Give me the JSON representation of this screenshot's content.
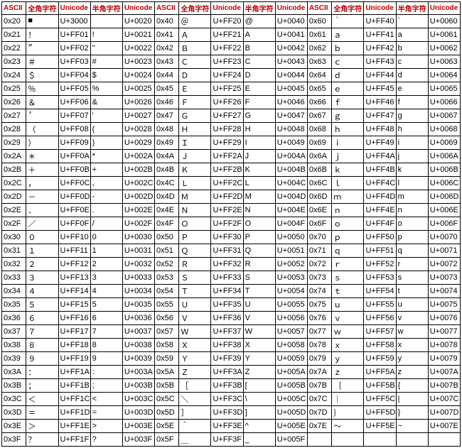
{
  "headers": [
    "ASCII",
    "全角字符",
    "Unicode",
    "半角字符",
    "Unicode"
  ],
  "rows": [
    {
      "a": "0x20",
      "f": "■",
      "u1": "U+3000",
      "h": " ",
      "u2": "U+0020",
      "a2": "0x40",
      "f2": "＠",
      "u12": "U+FF20",
      "h2": "@",
      "u22": "U+0040",
      "a3": "0x60",
      "f3": "｀",
      "u13": "U+FF40",
      "h3": "`",
      "u23": "U+0060"
    },
    {
      "a": "0x21",
      "f": "！",
      "u1": "U+FF01",
      "h": "!",
      "u2": "U+0021",
      "a2": "0x41",
      "f2": "Ａ",
      "u12": "U+FF21",
      "h2": "A",
      "u22": "U+0041",
      "a3": "0x61",
      "f3": "ａ",
      "u13": "U+FF41",
      "h3": "a",
      "u23": "U+0061"
    },
    {
      "a": "0x22",
      "f": "”",
      "u1": "U+FF02",
      "h": "\"",
      "u2": "U+0022",
      "a2": "0x42",
      "f2": "Ｂ",
      "u12": "U+FF22",
      "h2": "B",
      "u22": "U+0042",
      "a3": "0x62",
      "f3": "ｂ",
      "u13": "U+FF42",
      "h3": "b",
      "u23": "U+0062"
    },
    {
      "a": "0x23",
      "f": "＃",
      "u1": "U+FF03",
      "h": "#",
      "u2": "U+0023",
      "a2": "0x43",
      "f2": "Ｃ",
      "u12": "U+FF23",
      "h2": "C",
      "u22": "U+0043",
      "a3": "0x63",
      "f3": "ｃ",
      "u13": "U+FF43",
      "h3": "c",
      "u23": "U+0063"
    },
    {
      "a": "0x24",
      "f": "＄",
      "u1": "U+FF04",
      "h": "$",
      "u2": "U+0024",
      "a2": "0x44",
      "f2": "Ｄ",
      "u12": "U+FF24",
      "h2": "D",
      "u22": "U+0044",
      "a3": "0x64",
      "f3": "ｄ",
      "u13": "U+FF44",
      "h3": "d",
      "u23": "U+0064"
    },
    {
      "a": "0x25",
      "f": "％",
      "u1": "U+FF05",
      "h": "%",
      "u2": "U+0025",
      "a2": "0x45",
      "f2": "Ｅ",
      "u12": "U+FF25",
      "h2": "E",
      "u22": "U+0045",
      "a3": "0x65",
      "f3": "ｅ",
      "u13": "U+FF45",
      "h3": "e",
      "u23": "U+0065"
    },
    {
      "a": "0x26",
      "f": "＆",
      "u1": "U+FF06",
      "h": "&",
      "u2": "U+0026",
      "a2": "0x46",
      "f2": "Ｆ",
      "u12": "U+FF26",
      "h2": "F",
      "u22": "U+0046",
      "a3": "0x66",
      "f3": "ｆ",
      "u13": "U+FF46",
      "h3": "f",
      "u23": "U+0066"
    },
    {
      "a": "0x27",
      "f": "’",
      "u1": "U+FF07",
      "h": "'",
      "u2": "U+0027",
      "a2": "0x47",
      "f2": "Ｇ",
      "u12": "U+FF27",
      "h2": "G",
      "u22": "U+0047",
      "a3": "0x67",
      "f3": "ｇ",
      "u13": "U+FF47",
      "h3": "g",
      "u23": "U+0067"
    },
    {
      "a": "0x28",
      "f": "（",
      "u1": "U+FF08",
      "h": "(",
      "u2": "U+0028",
      "a2": "0x48",
      "f2": "Ｈ",
      "u12": "U+FF28",
      "h2": "H",
      "u22": "U+0048",
      "a3": "0x68",
      "f3": "ｈ",
      "u13": "U+FF48",
      "h3": "h",
      "u23": "U+0068"
    },
    {
      "a": "0x29",
      "f": "）",
      "u1": "U+FF09",
      "h": ")",
      "u2": "U+0029",
      "a2": "0x49",
      "f2": "Ｉ",
      "u12": "U+FF29",
      "h2": "I",
      "u22": "U+0049",
      "a3": "0x69",
      "f3": "ｉ",
      "u13": "U+FF49",
      "h3": "i",
      "u23": "U+0069"
    },
    {
      "a": "0x2A",
      "f": "＊",
      "u1": "U+FF0A",
      "h": "*",
      "u2": "U+002A",
      "a2": "0x4A",
      "f2": "Ｊ",
      "u12": "U+FF2A",
      "h2": "J",
      "u22": "U+004A",
      "a3": "0x6A",
      "f3": "ｊ",
      "u13": "U+FF4A",
      "h3": "j",
      "u23": "U+006A"
    },
    {
      "a": "0x2B",
      "f": "＋",
      "u1": "U+FF0B",
      "h": "+",
      "u2": "U+002B",
      "a2": "0x4B",
      "f2": "Ｋ",
      "u12": "U+FF2B",
      "h2": "K",
      "u22": "U+004B",
      "a3": "0x6B",
      "f3": "ｋ",
      "u13": "U+FF4B",
      "h3": "k",
      "u23": "U+006B"
    },
    {
      "a": "0x2C",
      "f": "，",
      "u1": "U+FF0C",
      "h": ",",
      "u2": "U+002C",
      "a2": "0x4C",
      "f2": "Ｌ",
      "u12": "U+FF2C",
      "h2": "L",
      "u22": "U+004C",
      "a3": "0x6C",
      "f3": "ｌ",
      "u13": "U+FF4C",
      "h3": "l",
      "u23": "U+006C"
    },
    {
      "a": "0x2D",
      "f": "－",
      "u1": "U+FF0D",
      "h": "-",
      "u2": "U+002D",
      "a2": "0x4D",
      "f2": "Ｍ",
      "u12": "U+FF2D",
      "h2": "M",
      "u22": "U+004D",
      "a3": "0x6D",
      "f3": "ｍ",
      "u13": "U+FF4D",
      "h3": "m",
      "u23": "U+006D"
    },
    {
      "a": "0x2E",
      "f": "．",
      "u1": "U+FF0E",
      "h": ".",
      "u2": "U+002E",
      "a2": "0x4E",
      "f2": "Ｎ",
      "u12": "U+FF2E",
      "h2": "N",
      "u22": "U+004E",
      "a3": "0x6E",
      "f3": "ｎ",
      "u13": "U+FF4E",
      "h3": "n",
      "u23": "U+006E"
    },
    {
      "a": "0x2F",
      "f": "／",
      "u1": "U+FF0F",
      "h": "/",
      "u2": "U+002F",
      "a2": "0x4F",
      "f2": "Ｏ",
      "u12": "U+FF2F",
      "h2": "O",
      "u22": "U+004F",
      "a3": "0x6F",
      "f3": "ｏ",
      "u13": "U+FF4F",
      "h3": "o",
      "u23": "U+006F"
    },
    {
      "a": "0x30",
      "f": "０",
      "u1": "U+FF10",
      "h": "0",
      "u2": "U+0030",
      "a2": "0x50",
      "f2": "Ｐ",
      "u12": "U+FF30",
      "h2": "P",
      "u22": "U+0050",
      "a3": "0x70",
      "f3": "ｐ",
      "u13": "U+FF50",
      "h3": "p",
      "u23": "U+0070"
    },
    {
      "a": "0x31",
      "f": "１",
      "u1": "U+FF11",
      "h": "1",
      "u2": "U+0031",
      "a2": "0x51",
      "f2": "Ｑ",
      "u12": "U+FF31",
      "h2": "Q",
      "u22": "U+0051",
      "a3": "0x71",
      "f3": "ｑ",
      "u13": "U+FF51",
      "h3": "q",
      "u23": "U+0071"
    },
    {
      "a": "0x32",
      "f": "２",
      "u1": "U+FF12",
      "h": "2",
      "u2": "U+0032",
      "a2": "0x52",
      "f2": "Ｒ",
      "u12": "U+FF32",
      "h2": "R",
      "u22": "U+0052",
      "a3": "0x72",
      "f3": "ｒ",
      "u13": "U+FF52",
      "h3": "r",
      "u23": "U+0072"
    },
    {
      "a": "0x33",
      "f": "３",
      "u1": "U+FF13",
      "h": "3",
      "u2": "U+0033",
      "a2": "0x53",
      "f2": "Ｓ",
      "u12": "U+FF33",
      "h2": "S",
      "u22": "U+0053",
      "a3": "0x73",
      "f3": "ｓ",
      "u13": "U+FF53",
      "h3": "s",
      "u23": "U+0073"
    },
    {
      "a": "0x34",
      "f": "４",
      "u1": "U+FF14",
      "h": "4",
      "u2": "U+0034",
      "a2": "0x54",
      "f2": "Ｔ",
      "u12": "U+FF34",
      "h2": "T",
      "u22": "U+0054",
      "a3": "0x74",
      "f3": "ｔ",
      "u13": "U+FF54",
      "h3": "t",
      "u23": "U+0074"
    },
    {
      "a": "0x35",
      "f": "５",
      "u1": "U+FF15",
      "h": "5",
      "u2": "U+0035",
      "a2": "0x55",
      "f2": "Ｕ",
      "u12": "U+FF35",
      "h2": "U",
      "u22": "U+0055",
      "a3": "0x75",
      "f3": "ｕ",
      "u13": "U+FF55",
      "h3": "u",
      "u23": "U+0075"
    },
    {
      "a": "0x36",
      "f": "６",
      "u1": "U+FF16",
      "h": "6",
      "u2": "U+0036",
      "a2": "0x56",
      "f2": "Ｖ",
      "u12": "U+FF36",
      "h2": "V",
      "u22": "U+0056",
      "a3": "0x76",
      "f3": "ｖ",
      "u13": "U+FF56",
      "h3": "v",
      "u23": "U+0076"
    },
    {
      "a": "0x37",
      "f": "７",
      "u1": "U+FF17",
      "h": "7",
      "u2": "U+0037",
      "a2": "0x57",
      "f2": "Ｗ",
      "u12": "U+FF37",
      "h2": "W",
      "u22": "U+0057",
      "a3": "0x77",
      "f3": "ｗ",
      "u13": "U+FF57",
      "h3": "w",
      "u23": "U+0077"
    },
    {
      "a": "0x38",
      "f": "８",
      "u1": "U+FF18",
      "h": "8",
      "u2": "U+0038",
      "a2": "0x58",
      "f2": "Ｘ",
      "u12": "U+FF38",
      "h2": "X",
      "u22": "U+0058",
      "a3": "0x78",
      "f3": "ｘ",
      "u13": "U+FF58",
      "h3": "x",
      "u23": "U+0078"
    },
    {
      "a": "0x39",
      "f": "９",
      "u1": "U+FF19",
      "h": "9",
      "u2": "U+0039",
      "a2": "0x59",
      "f2": "Ｙ",
      "u12": "U+FF39",
      "h2": "Y",
      "u22": "U+0059",
      "a3": "0x79",
      "f3": "ｙ",
      "u13": "U+FF59",
      "h3": "y",
      "u23": "U+0079"
    },
    {
      "a": "0x3A",
      "f": "：",
      "u1": "U+FF1A",
      "h": ":",
      "u2": "U+003A",
      "a2": "0x5A",
      "f2": "Ｚ",
      "u12": "U+FF3A",
      "h2": "Z",
      "u22": "U+005A",
      "a3": "0x7A",
      "f3": "ｚ",
      "u13": "U+FF5A",
      "h3": "z",
      "u23": "U+007A"
    },
    {
      "a": "0x3B",
      "f": "；",
      "u1": "U+FF1B",
      "h": ";",
      "u2": "U+003B",
      "a2": "0x5B",
      "f2": "［",
      "u12": "U+FF3B",
      "h2": "[",
      "u22": "U+005B",
      "a3": "0x7B",
      "f3": "｛",
      "u13": "U+FF5B",
      "h3": "{",
      "u23": "U+007B"
    },
    {
      "a": "0x3C",
      "f": "＜",
      "u1": "U+FF1C",
      "h": "<",
      "u2": "U+003C",
      "a2": "0x5C",
      "f2": "＼",
      "u12": "U+FF3C",
      "h2": "\\",
      "u22": "U+005C",
      "a3": "0x7C",
      "f3": "｜",
      "u13": "U+FF5C",
      "h3": "|",
      "u23": "U+007C"
    },
    {
      "a": "0x3D",
      "f": "＝",
      "u1": "U+FF1D",
      "h": "=",
      "u2": "U+003D",
      "a2": "0x5D",
      "f2": "］",
      "u12": "U+FF3D",
      "h2": "]",
      "u22": "U+005D",
      "a3": "0x7D",
      "f3": "｝",
      "u13": "U+FF5D",
      "h3": "}",
      "u23": "U+007D"
    },
    {
      "a": "0x3E",
      "f": "＞",
      "u1": "U+FF1E",
      "h": ">",
      "u2": "U+003E",
      "a2": "0x5E",
      "f2": "＾",
      "u12": "U+FF3E",
      "h2": "^",
      "u22": "U+005E",
      "a3": "0x7E",
      "f3": "～",
      "u13": "U+FF5E",
      "h3": "~",
      "u23": "U+007E"
    },
    {
      "a": "0x3F",
      "f": "？",
      "u1": "U+FF1F",
      "h": "?",
      "u2": "U+003F",
      "a2": "0x5F",
      "f2": "＿",
      "u12": "U+FF3F",
      "h2": "_",
      "u22": "U+005F",
      "a3": "",
      "f3": "",
      "u13": "",
      "h3": "",
      "u23": ""
    }
  ]
}
